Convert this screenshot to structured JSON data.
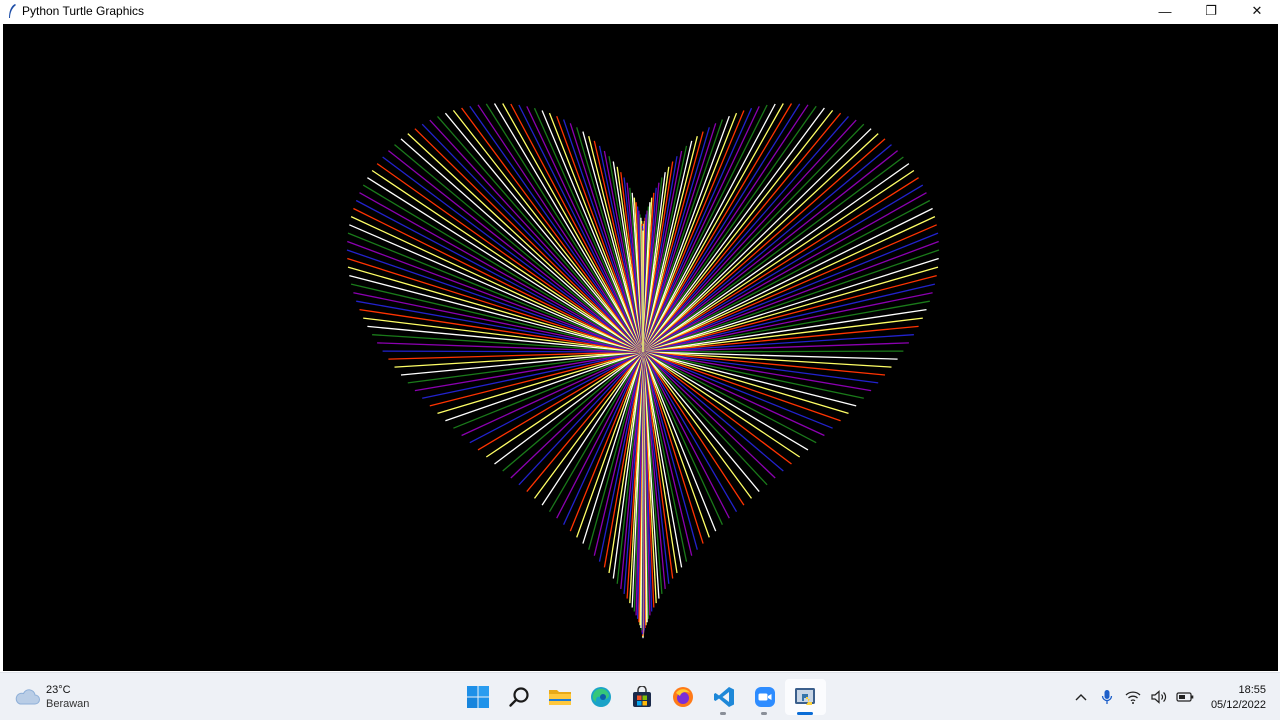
{
  "window": {
    "title": "Python Turtle Graphics",
    "controls": {
      "minimize": "—",
      "restore": "❐",
      "close": "✕"
    }
  },
  "canvas": {
    "background": "#000000",
    "artwork": "heart-of-radiating-lines",
    "line_colors": [
      "#ffffff",
      "#ffff66",
      "#ff3300",
      "#2222cc",
      "#8b00b0",
      "#1a7a1a"
    ]
  },
  "taskbar": {
    "weather": {
      "temp": "23°C",
      "desc": "Berawan",
      "icon": "cloud-icon"
    },
    "apps": [
      {
        "name": "start-button",
        "icon": "windows-logo-icon"
      },
      {
        "name": "search-button",
        "icon": "search-icon"
      },
      {
        "name": "file-explorer",
        "icon": "folder-icon"
      },
      {
        "name": "edge",
        "icon": "edge-icon"
      },
      {
        "name": "store",
        "icon": "store-icon"
      },
      {
        "name": "firefox",
        "icon": "firefox-icon"
      },
      {
        "name": "vscode",
        "icon": "vscode-icon"
      },
      {
        "name": "zoom",
        "icon": "zoom-icon"
      },
      {
        "name": "python",
        "icon": "python-icon"
      }
    ],
    "tray": {
      "icons": [
        "chevron-up-icon",
        "microphone-icon",
        "wifi-icon",
        "speaker-icon",
        "battery-icon"
      ]
    },
    "clock": {
      "time": "18:55",
      "date": "05/12/2022"
    }
  }
}
